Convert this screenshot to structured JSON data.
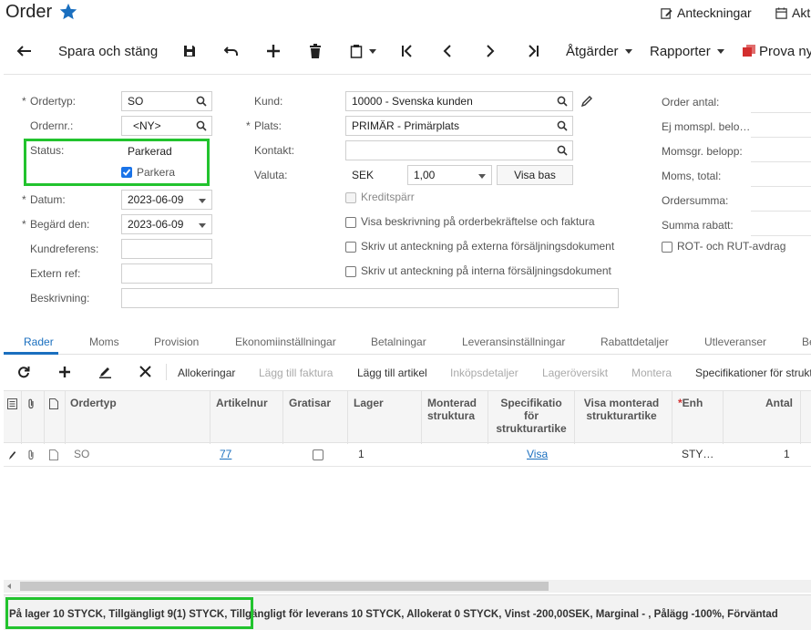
{
  "header": {
    "title": "Order",
    "notes_label": "Anteckningar",
    "activities_label": "Akt"
  },
  "toolbar": {
    "save_close": "Spara och stäng",
    "actions": "Åtgärder",
    "reports": "Rapporter",
    "try_new": "Prova ny"
  },
  "form": {
    "ordertype": {
      "label": "Ordertyp:",
      "value": "SO"
    },
    "ordernr": {
      "label": "Ordernr.:",
      "value": "<NY>"
    },
    "status": {
      "label": "Status:",
      "value": "Parkerad"
    },
    "park": {
      "label": "Parkera",
      "checked": true
    },
    "date": {
      "label": "Datum:",
      "value": "2023-06-09"
    },
    "requested": {
      "label": "Begärd den:",
      "value": "2023-06-09"
    },
    "customer_ref": {
      "label": "Kundreferens:",
      "value": ""
    },
    "external_ref": {
      "label": "Extern ref:",
      "value": ""
    },
    "description": {
      "label": "Beskrivning:",
      "value": ""
    },
    "customer": {
      "label": "Kund:",
      "value": "10000 - Svenska kunden"
    },
    "location": {
      "label": "Plats:",
      "value": "PRIMÄR - Primärplats"
    },
    "contact": {
      "label": "Kontakt:",
      "value": ""
    },
    "currency": {
      "label": "Valuta:",
      "value": "SEK",
      "rate": "1,00",
      "show_base": "Visa bas"
    },
    "credit_hold": "Kreditspärr",
    "show_desc": "Visa beskrivning på orderbekräftelse och faktura",
    "print_ext": "Skriv ut anteckning på externa försäljningsdokument",
    "print_int": "Skriv ut anteckning på interna försäljningsdokument",
    "order_qty": "Order antal:",
    "not_taxable": "Ej momspl. belo…",
    "taxable": "Momsgr. belopp:",
    "tax_total": "Moms, total:",
    "order_total": "Ordersumma:",
    "discount_total": "Summa rabatt:",
    "rot_rut": "ROT- och RUT-avdrag"
  },
  "tabs": [
    "Rader",
    "Moms",
    "Provision",
    "Ekonomiinställningar",
    "Betalningar",
    "Leveransinställningar",
    "Rabattdetaljer",
    "Utleveranser",
    "Be"
  ],
  "grid_toolbar": {
    "allocations": "Allokeringar",
    "add_invoice": "Lägg till faktura",
    "add_item": "Lägg till artikel",
    "purchase_details": "Inköpsdetaljer",
    "stock_overview": "Lageröversikt",
    "assemble": "Montera",
    "specs": "Specifikationer för strukt"
  },
  "grid": {
    "columns": {
      "ordertype": "Ordertyp",
      "item": "Artikelnur",
      "free": "Gratisar",
      "warehouse": "Lager",
      "assembled": "Monterad struktura",
      "spec": "Specifikatio för strukturartike",
      "show_assembled": "Visa monterad strukturartike",
      "unit": "Enh",
      "qty": "Antal"
    },
    "rows": [
      {
        "ordertype": "SO",
        "item": "77",
        "warehouse": "1",
        "spec": "Visa",
        "unit": "STY…",
        "qty": "1"
      }
    ]
  },
  "status_bar": "På lager 10 STYCK, Tillgängligt 9(1) STYCK, Tillgängligt för leverans 10 STYCK, Allokerat 0 STYCK, Vinst -200,00SEK, Marginal - , Pålägg -100%, Förväntad"
}
